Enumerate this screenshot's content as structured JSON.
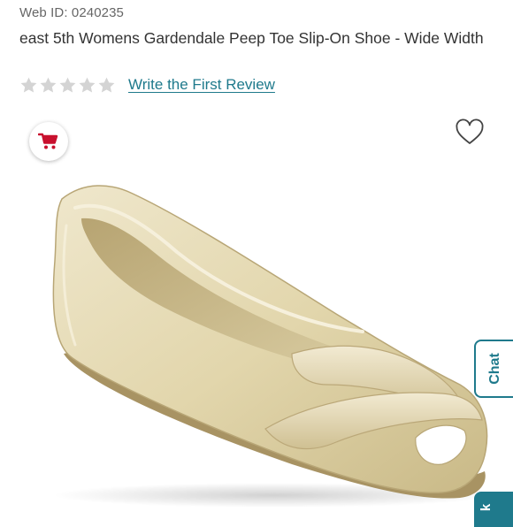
{
  "product": {
    "web_id": "Web ID: 0240235",
    "title": "east 5th Womens Gardendale Peep Toe Slip-On Shoe - Wide Width",
    "rating": {
      "stars_filled": 0,
      "stars_total": 5,
      "review_link": "Write the First Review"
    },
    "image_name": "shoe-product-image"
  },
  "actions": {
    "cart_icon": "shopping-cart-icon",
    "favorite_icon": "heart-outline-icon"
  },
  "side_tabs": {
    "chat_label": "Chat",
    "feedback_label": "k"
  },
  "colors": {
    "link": "#1f7a8c",
    "cart_red": "#c8102e",
    "star_empty": "#d4d4d4",
    "title_text": "#333333",
    "web_id_text": "#666666"
  }
}
